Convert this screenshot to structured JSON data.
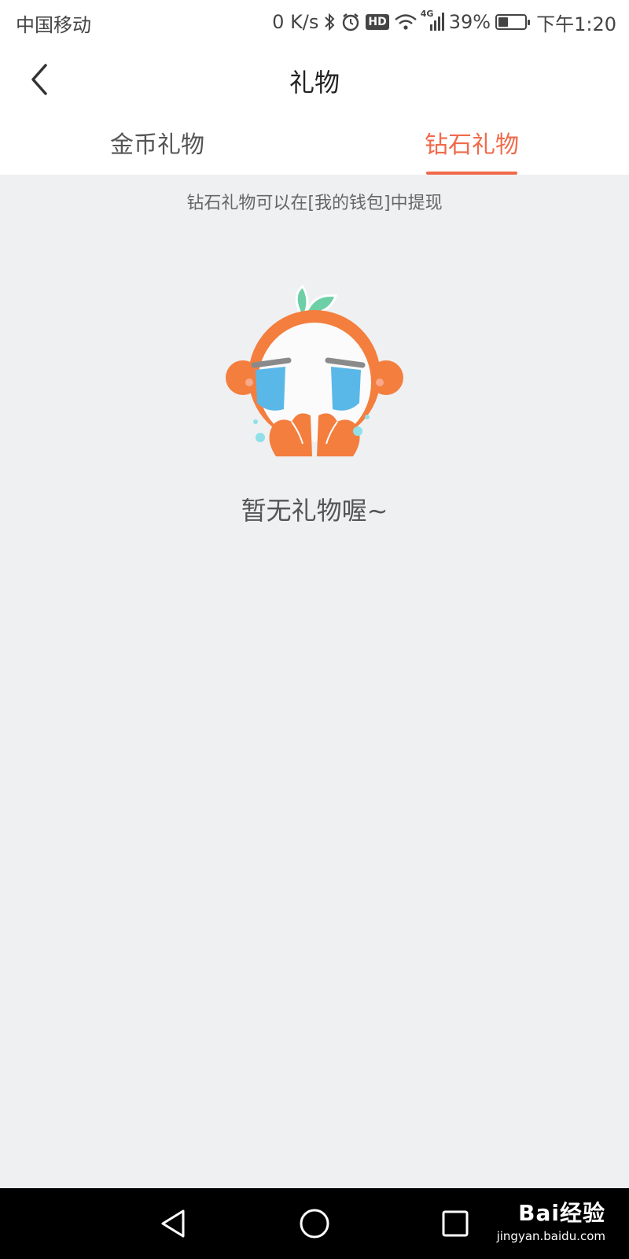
{
  "status_bar": {
    "carrier": "中国移动",
    "net_speed": "0 K/s",
    "hd_badge": "HD",
    "network_type": "4G",
    "battery_percent": "39%",
    "battery_level": 0.39,
    "time": "下午1:20",
    "icons": [
      "bluetooth-icon",
      "alarm-icon",
      "hd-icon",
      "wifi-icon",
      "signal-icon",
      "battery-icon"
    ]
  },
  "header": {
    "title": "礼物",
    "back_icon": "chevron-left-icon"
  },
  "tabs": [
    {
      "label": "金币礼物",
      "active": false
    },
    {
      "label": "钻石礼物",
      "active": true
    }
  ],
  "content": {
    "tip": "钻石礼物可以在[我的钱包]中提现",
    "empty_text": "暂无礼物喔~",
    "illustration": "crying-orange-mascot"
  },
  "colors": {
    "accent": "#f06a4a",
    "background": "#eff0f2",
    "mascot_orange": "#f47e3e",
    "tear_blue": "#5ab8e8",
    "leaf_green": "#6dcfa6"
  },
  "system_nav": {
    "buttons": [
      "back-triangle-icon",
      "home-circle-icon",
      "recents-square-icon"
    ]
  },
  "watermark": {
    "brand": "Bai经验",
    "url": "jingyan.baidu.com"
  }
}
